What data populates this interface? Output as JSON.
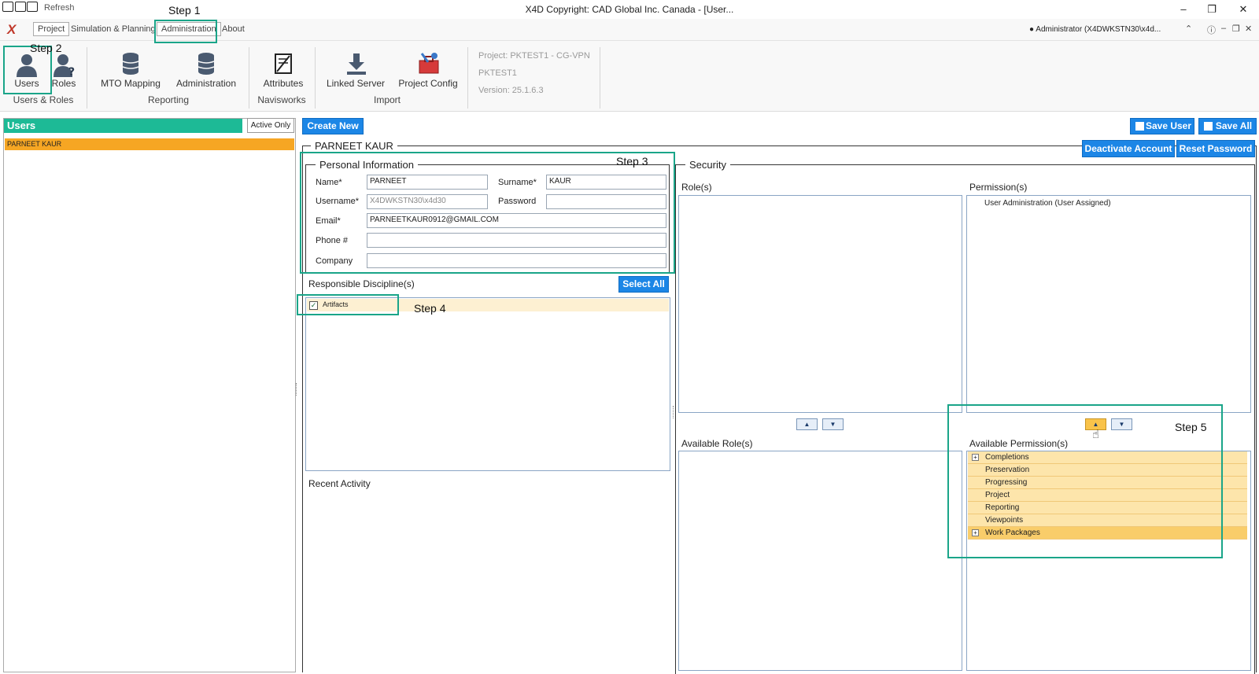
{
  "window": {
    "title": "X4D Copyright: CAD Global Inc. Canada - [User...",
    "refresh_label": "Refresh",
    "min": "–",
    "max": "❐",
    "close": "✕"
  },
  "menu": {
    "logo": "X",
    "items": [
      "Project",
      "Simulation & Planning",
      "Administration",
      "About"
    ],
    "user": "Administrator  (X4DWKSTN30\\x4d..."
  },
  "ribbon": {
    "users_label": "Users",
    "roles_label": "Roles",
    "users_roles_group": "Users & Roles",
    "mto_label": "MTO Mapping",
    "admin_label": "Administration",
    "reporting_group": "Reporting",
    "attributes_label": "Attributes",
    "navisworks_group": "Navisworks",
    "linked_server_label": "Linked Server",
    "project_config_label": "Project Config",
    "import_group": "Import",
    "project_line": "Project: PKTEST1 - CG-VPN",
    "project_code": "PKTEST1",
    "version": "Version: 25.1.6.3"
  },
  "users_panel": {
    "header": "Users",
    "active_only": "Active Only",
    "rows": [
      "PARNEET KAUR"
    ]
  },
  "toolbar": {
    "create_new": "Create New",
    "save_user": "Save User",
    "save_all": "Save All",
    "deactivate": "Deactivate Account",
    "reset_password": "Reset Password"
  },
  "form": {
    "user_title": "PARNEET KAUR",
    "personal_legend": "Personal Information",
    "name_label": "Name*",
    "name_value": "PARNEET",
    "surname_label": "Surname*",
    "surname_value": "KAUR",
    "username_label": "Username*",
    "username_value": "X4DWKSTN30\\x4d30",
    "password_label": "Password",
    "password_value": "",
    "email_label": "Email*",
    "email_value": "PARNEETKAUR0912@GMAIL.COM",
    "phone_label": "Phone #",
    "phone_value": "",
    "company_label": "Company",
    "company_value": "",
    "disciplines_label": "Responsible Discipline(s)",
    "select_all": "Select All",
    "disciplines": [
      {
        "label": "Artifacts",
        "checked": true
      }
    ],
    "recent_activity": "Recent Activity"
  },
  "security": {
    "legend": "Security",
    "roles_label": "Role(s)",
    "permissions_label": "Permission(s)",
    "assigned_permissions": [
      "User Administration (User Assigned)"
    ],
    "available_roles_label": "Available Role(s)",
    "available_permissions_label": "Available Permission(s)",
    "available_permissions": [
      {
        "label": "Completions",
        "expandable": true
      },
      {
        "label": "Preservation",
        "expandable": false
      },
      {
        "label": "Progressing",
        "expandable": false
      },
      {
        "label": "Project",
        "expandable": false
      },
      {
        "label": "Reporting",
        "expandable": false
      },
      {
        "label": "Viewpoints",
        "expandable": false
      },
      {
        "label": "Work Packages",
        "expandable": true
      }
    ],
    "up": "▲",
    "down": "▼"
  },
  "annotations": {
    "step1": "Step 1",
    "step2": "Step 2",
    "step3": "Step 3",
    "step4": "Step 4",
    "step5": "Step 5"
  },
  "colors": {
    "accent": "#1c86e6",
    "users_header": "#1dba96",
    "selected_row": "#f6a623",
    "step_box": "#1aa589"
  }
}
